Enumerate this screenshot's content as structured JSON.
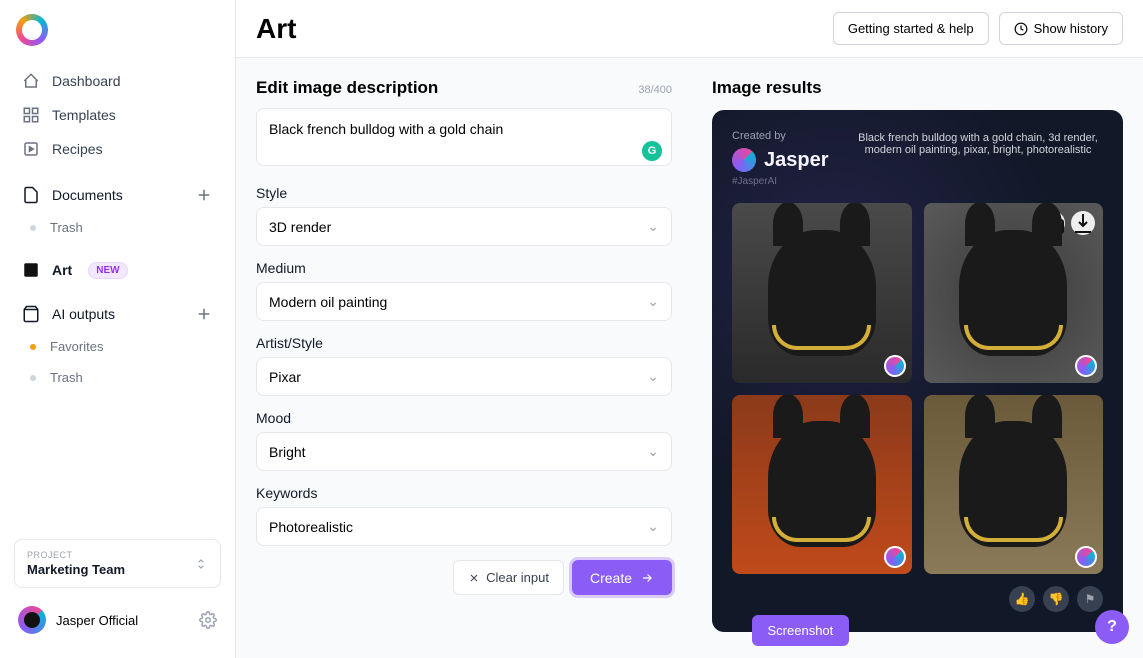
{
  "sidebar": {
    "items": [
      {
        "label": "Dashboard"
      },
      {
        "label": "Templates"
      },
      {
        "label": "Recipes"
      }
    ],
    "documents": {
      "label": "Documents",
      "trash": "Trash"
    },
    "art": {
      "label": "Art",
      "badge": "NEW"
    },
    "outputs": {
      "label": "AI outputs",
      "favorites": "Favorites",
      "trash": "Trash"
    },
    "project": {
      "label": "PROJECT",
      "name": "Marketing Team"
    },
    "user": {
      "name": "Jasper Official"
    }
  },
  "header": {
    "title": "Art",
    "help_btn": "Getting started & help",
    "history_btn": "Show history"
  },
  "form": {
    "title": "Edit image description",
    "char_count": "38/400",
    "prompt": "Black french bulldog with a gold chain",
    "fields": {
      "style": {
        "label": "Style",
        "value": "3D render"
      },
      "medium": {
        "label": "Medium",
        "value": "Modern oil painting"
      },
      "artist": {
        "label": "Artist/Style",
        "value": "Pixar"
      },
      "mood": {
        "label": "Mood",
        "value": "Bright"
      },
      "keywords": {
        "label": "Keywords",
        "value": "Photorealistic"
      }
    },
    "clear_btn": "Clear input",
    "create_btn": "Create"
  },
  "results": {
    "title": "Image results",
    "created_by": "Created by",
    "creator": "Jasper",
    "hashtag": "#JasperAI",
    "prompt_summary": "Black french bulldog with a gold chain, 3d render, modern oil painting, pixar, bright, photorealistic"
  },
  "screenshot_btn": "Screenshot",
  "help_fab": "?"
}
